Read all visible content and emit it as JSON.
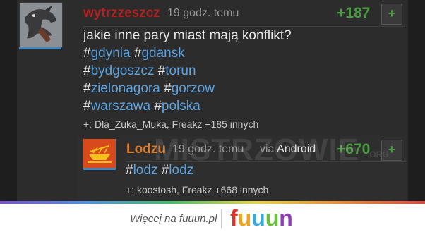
{
  "comment": {
    "username": "wytrzzeszcz",
    "time": "19 godz. temu",
    "score": "+187",
    "vote_label": "+",
    "text": "jakie inne pary miast mają konflikt?",
    "tag_lines": [
      [
        "gdynia",
        "gdansk"
      ],
      [
        "bydgoszcz",
        "torun"
      ],
      [
        "zielonagora",
        "gorzow"
      ],
      [
        "warszawa",
        "polska"
      ]
    ],
    "voters": "+: Dla_Zuka_Muka, Freakz +185 innych"
  },
  "reply": {
    "username": "Lodzu",
    "time": "19 godz. temu",
    "via_label": "via",
    "via_device": "Android",
    "score": "+670",
    "vote_label": "+",
    "tags": [
      "lodz",
      "lodz"
    ],
    "voters": "+: koostosh, Freakz +668 innych"
  },
  "hash_symbol": "#",
  "watermark": {
    "text": "MISTRZOWIE",
    "suffix": ".ORG"
  },
  "footer": {
    "more_text": "Więcej na fuuun.pl",
    "brand_letters": [
      {
        "char": "f",
        "color": "#e0342b"
      },
      {
        "char": "u",
        "color": "#f2a21a"
      },
      {
        "char": "u",
        "color": "#39a8dc"
      },
      {
        "char": "u",
        "color": "#6bbf3f"
      },
      {
        "char": "n",
        "color": "#8a3fb8"
      }
    ]
  },
  "colors": {
    "panel": "#2c2c2c",
    "username_red": "#b22020",
    "username_orange": "#d87a2a",
    "score_green": "#4a9a42",
    "tag_blue": "#5aa2e0"
  }
}
